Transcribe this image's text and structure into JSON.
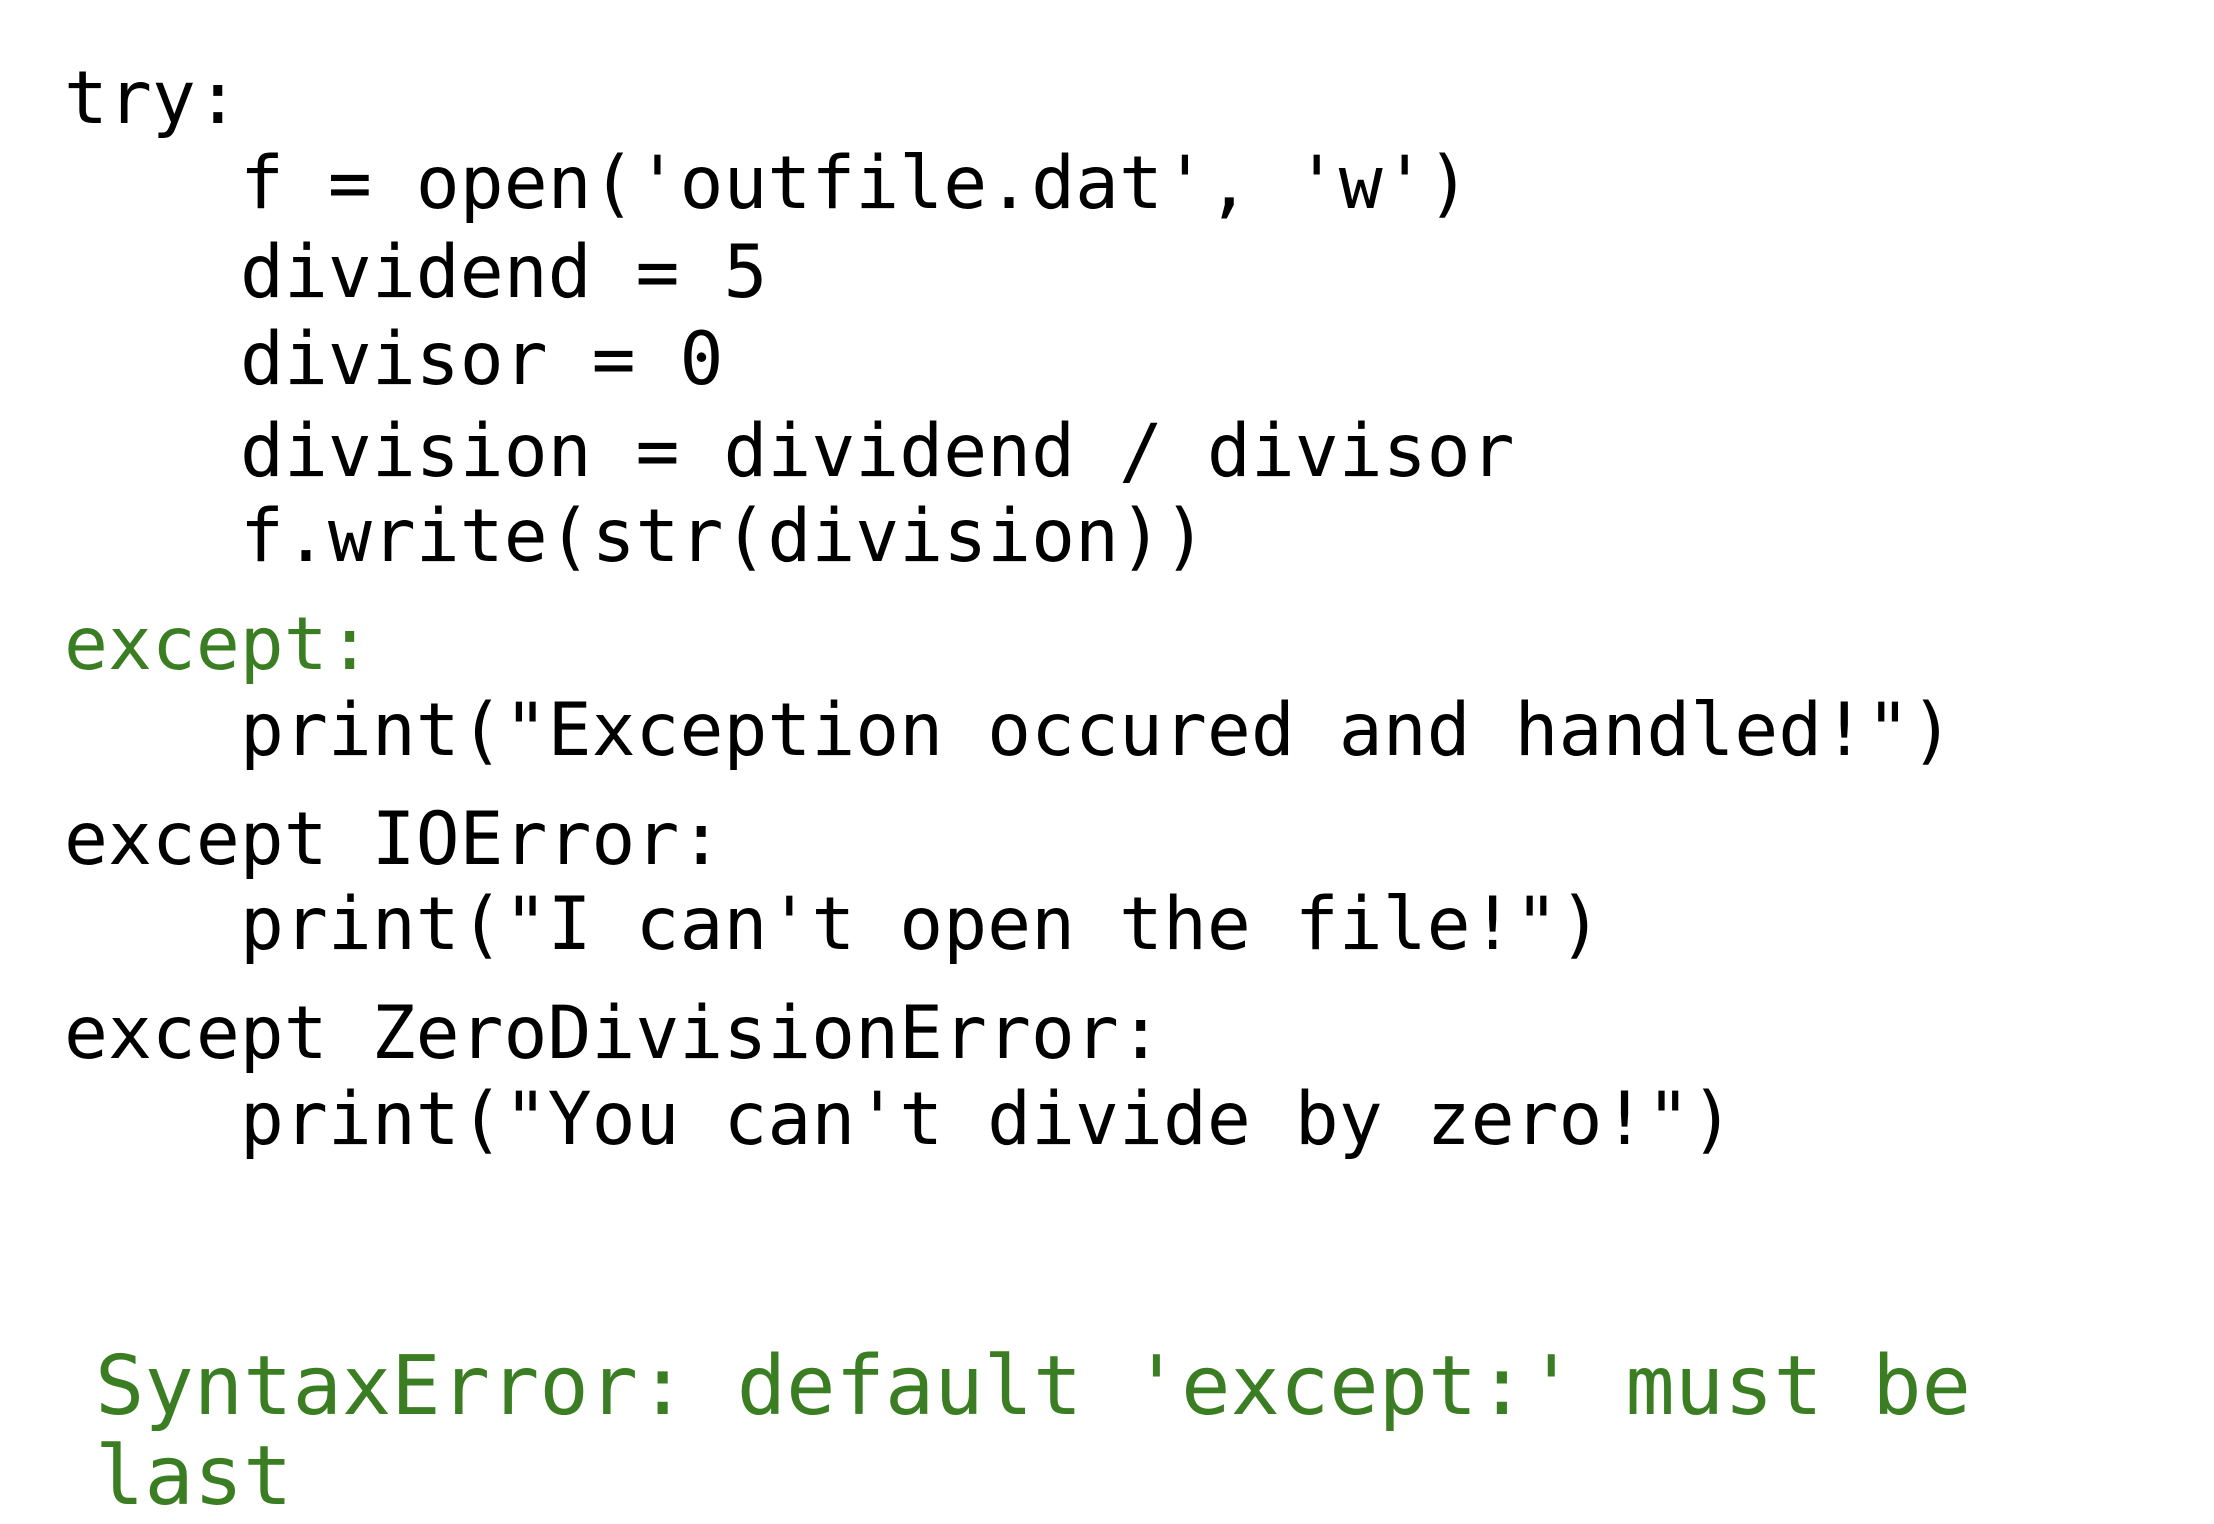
{
  "code_lines": [
    {
      "indent": 0,
      "text": "try:",
      "highlight": false
    },
    {
      "indent": 1,
      "text": "f = open('outfile.dat', 'w')",
      "highlight": false
    },
    {
      "indent": 1,
      "text": "dividend = 5",
      "highlight": false
    },
    {
      "indent": 1,
      "text": "divisor = 0",
      "highlight": false
    },
    {
      "indent": 1,
      "text": "division = dividend / divisor",
      "highlight": false
    },
    {
      "indent": 1,
      "text": "f.write(str(division))",
      "highlight": false
    },
    {
      "indent": 0,
      "text": "except:",
      "highlight": true
    },
    {
      "indent": 1,
      "text": "print(\"Exception occured and handled!\")",
      "highlight": false
    },
    {
      "indent": 0,
      "text": "except IOError:",
      "highlight": false
    },
    {
      "indent": 1,
      "text": "print(\"I can't open the file!\")",
      "highlight": false
    },
    {
      "indent": 0,
      "text": "except ZeroDivisionError:",
      "highlight": false
    },
    {
      "indent": 1,
      "text": "print(\"You can't divide by zero!\")",
      "highlight": false
    }
  ],
  "error_message": "SyntaxError: default 'except:' must be last",
  "colors": {
    "highlight": "#3a7d22",
    "text": "#000000",
    "background": "#ffffff"
  }
}
